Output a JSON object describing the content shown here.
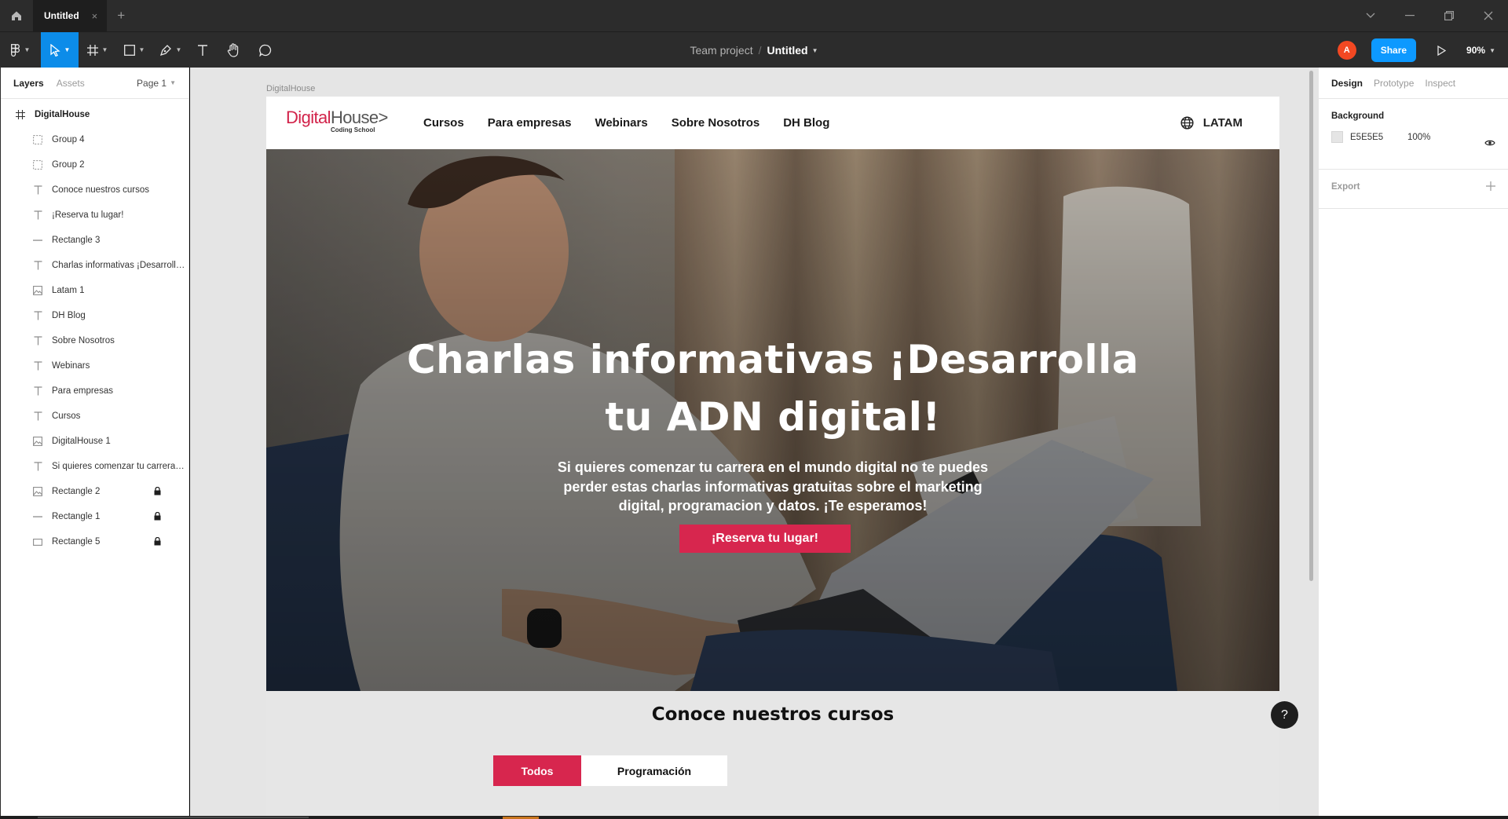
{
  "tabbar": {
    "tab_title": "Untitled",
    "close_symbol": "×",
    "add_symbol": "+"
  },
  "toolbar": {
    "breadcrumb_team": "Team project",
    "breadcrumb_sep": "/",
    "file_name": "Untitled",
    "avatar_initial": "A",
    "share_label": "Share",
    "zoom_label": "90%"
  },
  "left_panel": {
    "tab_layers": "Layers",
    "tab_assets": "Assets",
    "page_selector": "Page 1",
    "frame_name": "DigitalHouse",
    "layers": [
      {
        "label": "Group 4",
        "icon": "group-icon",
        "locked": false
      },
      {
        "label": "Group 2",
        "icon": "group-icon",
        "locked": false
      },
      {
        "label": "Conoce nuestros cursos",
        "icon": "text-icon",
        "locked": false
      },
      {
        "label": "¡Reserva tu lugar!",
        "icon": "text-icon",
        "locked": false
      },
      {
        "label": "Rectangle 3",
        "icon": "line-icon",
        "locked": false
      },
      {
        "label": "Charlas informativas ¡Desarrolla tu ADN digital!",
        "icon": "text-icon",
        "locked": false
      },
      {
        "label": "Latam 1",
        "icon": "image-icon",
        "locked": false
      },
      {
        "label": "DH Blog",
        "icon": "text-icon",
        "locked": false
      },
      {
        "label": "Sobre Nosotros",
        "icon": "text-icon",
        "locked": false
      },
      {
        "label": "Webinars",
        "icon": "text-icon",
        "locked": false
      },
      {
        "label": "Para empresas",
        "icon": "text-icon",
        "locked": false
      },
      {
        "label": "Cursos",
        "icon": "text-icon",
        "locked": false
      },
      {
        "label": "DigitalHouse 1",
        "icon": "image-icon",
        "locked": false
      },
      {
        "label": "Si quieres comenzar tu carrera en el mundo digital",
        "icon": "text-icon",
        "locked": false
      },
      {
        "label": "Rectangle 2",
        "icon": "image-icon",
        "locked": true
      },
      {
        "label": "Rectangle 1",
        "icon": "line-icon",
        "locked": true
      },
      {
        "label": "Rectangle 5",
        "icon": "rectangle-icon",
        "locked": true
      }
    ]
  },
  "canvas": {
    "frame_label": "DigitalHouse",
    "site": {
      "logo_digital": "Digital",
      "logo_house": "House",
      "logo_arrow": ">",
      "logo_tagline": "Coding School",
      "nav": [
        "Cursos",
        "Para empresas",
        "Webinars",
        "Sobre Nosotros",
        "DH Blog"
      ],
      "region": "LATAM",
      "hero_title_line1": "Charlas informativas ¡Desarrolla",
      "hero_title_line2": "tu ADN digital!",
      "hero_subtitle": "Si quieres comenzar tu carrera en el mundo digital no te puedes perder estas charlas informativas  gratuitas sobre el marketing digital, programacion y datos. ¡Te esperamos!",
      "cta_label": "¡Reserva tu lugar!",
      "courses_title": "Conoce nuestros cursos",
      "filter_all": "Todos",
      "filter_programming": "Programación",
      "accent_color": "#d7264e"
    },
    "help_label": "?"
  },
  "right_panel": {
    "tab_design": "Design",
    "tab_prototype": "Prototype",
    "tab_inspect": "Inspect",
    "background_heading": "Background",
    "background_hex": "E5E5E5",
    "background_opacity": "100%",
    "export_heading": "Export"
  },
  "colors": {
    "figma_blue": "#0c8ce9",
    "share_blue": "#0d99ff",
    "avatar_orange": "#f24822",
    "canvas_bg": "#e5e5e5"
  }
}
